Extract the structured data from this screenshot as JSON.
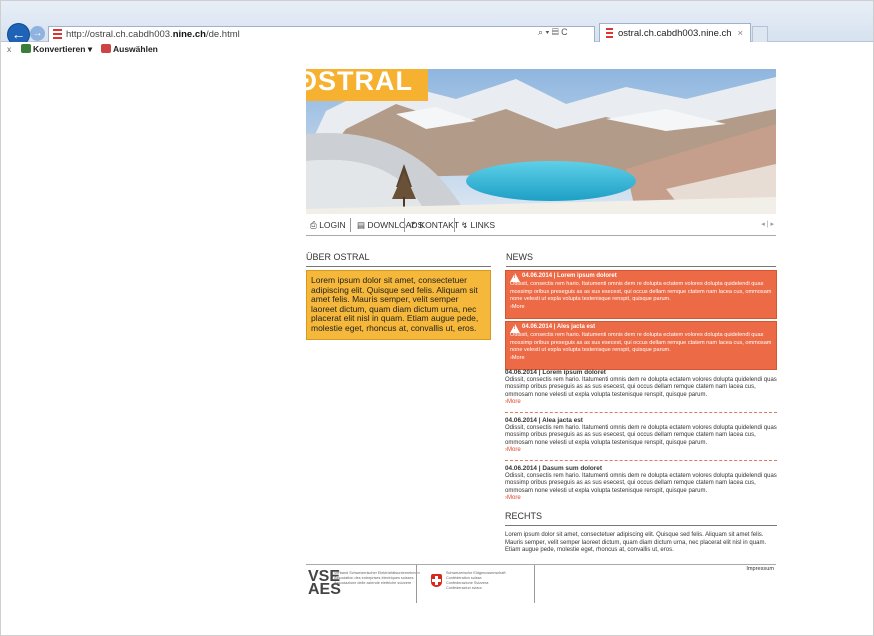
{
  "browser": {
    "url_prefix": "http://ostral.ch.cabdh003.",
    "url_host": "nine.ch",
    "url_path": "/de.html",
    "tab_title": "ostral.ch.cabdh003.nine.ch",
    "tab_close": "×",
    "addr_icons": "⌕ ▾ ▤ C",
    "back_glyph": "←",
    "fwd_glyph": "→",
    "cmd_close": "x",
    "cmd_convert": "Konvertieren",
    "cmd_convert_arrow": "▾",
    "cmd_select": "Auswählen"
  },
  "site": {
    "logo": "ʘSTRAL",
    "menu": [
      {
        "icon": "⎙",
        "label": "LOGIN"
      },
      {
        "icon": "▤",
        "label": "DOWNLOADS"
      },
      {
        "icon": "✆",
        "label": "KONTAKT"
      },
      {
        "icon": "↯",
        "label": "LINKS"
      }
    ],
    "pager": "◂ | ▸",
    "about_heading": "ÜBER OSTRAL",
    "about_text": "Lorem ipsum dolor sit amet, consectetuer adipiscing elit. Quisque sed felis. Aliquam sit amet felis. Mauris semper, velit semper laoreet dictum, quam diam dictum urna, nec placerat elit nisl in quam. Etiam augue pede, molestie eget, rhoncus at, convallis ut, eros.",
    "news_heading": "NEWS",
    "alerts": [
      {
        "title": "04.06.2014 | Lorem ipsum doloret",
        "text": "Odissit, consectis rem hario. Itatumenti omnis dem re dolupta ectatem volores dolupta quidelendi quas mossimp oribus preseguis as as sus esecest, qui occus dellam remque ctatem nam lacea cus, ommosam none velesti ut expla volupta testenisque renspit, quisque parum.",
        "more": "›More"
      },
      {
        "title": "04.06.2014 | Ales jacta est",
        "text": "Odissit, consectis rem hario. Itatumenti omnis dem re dolupta ectatem volores dolupta quidelendi quas mossimp oribus preseguis as as sus esecest, qui occus dellam remque ctatem nam lacea cus, ommosam none velesti ut expla volupta testenisque renspit, quisque parum.",
        "more": "›More"
      }
    ],
    "news": [
      {
        "title": "04.06.2014 | Lorem ipsum doloret",
        "text": "Odissit, consectis rem hario. Itatumenti omnis dem re dolupta ectatem volores dolupta quidelendi quas mossimp oribus preseguis as as sus esecest, qui occus dellam remque ctatem nam lacea cus, ommosam none velesti ut expla volupta testenisque renspit, quisque parum.",
        "more": "›More"
      },
      {
        "title": "04.06.2014 | Alea jacta est",
        "text": "Odissit, consectis rem hario. Itatumenti omnis dem re dolupta ectatem volores dolupta quidelendi quas mossimp oribus preseguis as as sus esecest, qui occus dellam remque ctatem nam lacea cus, ommosam none velesti ut expla volupta testenisque renspit, quisque parum.",
        "more": "›More"
      },
      {
        "title": "04.06.2014 | Dasum sum doloret",
        "text": "Odissit, consectis rem hario. Itatumenti omnis dem re dolupta ectatem volores dolupta quidelendi quas mossimp oribus preseguis as as sus esecest, qui occus dellam remque ctatem nam lacea cus, ommosam none velesti ut expla volupta testenisque renspit, quisque parum.",
        "more": "›More"
      }
    ],
    "rechts_heading": "RECHTS",
    "rechts_text": "Lorem ipsum dolor sit amet, consectetuer adipiscing elit. Quisque sed felis. Aliquam sit amet felis. Mauris semper, velit semper laoreet dictum, quam diam dictum urna, nec placerat elit nisl in quam. Etiam augue pede, molestie eget, rhoncus at, convallis ut, eros.",
    "footer_vse": "VSE\nAES",
    "footer_vse_text": "Verband Schweizerischer Elektrizitätsunternehmen\nAssociation des entreprises électriques suisses\nAssociazione delle aziende elettriche svizzere",
    "footer_conf_text": "Schweizerische Eidgenossenschaft\nConfédération suisse\nConfederazione Svizzera\nConfederaziun svizra",
    "impressum": "Impressum"
  },
  "colors": {
    "brand": "#f5b12f",
    "alert": "#ec6a46",
    "more_link": "#e2462a"
  }
}
